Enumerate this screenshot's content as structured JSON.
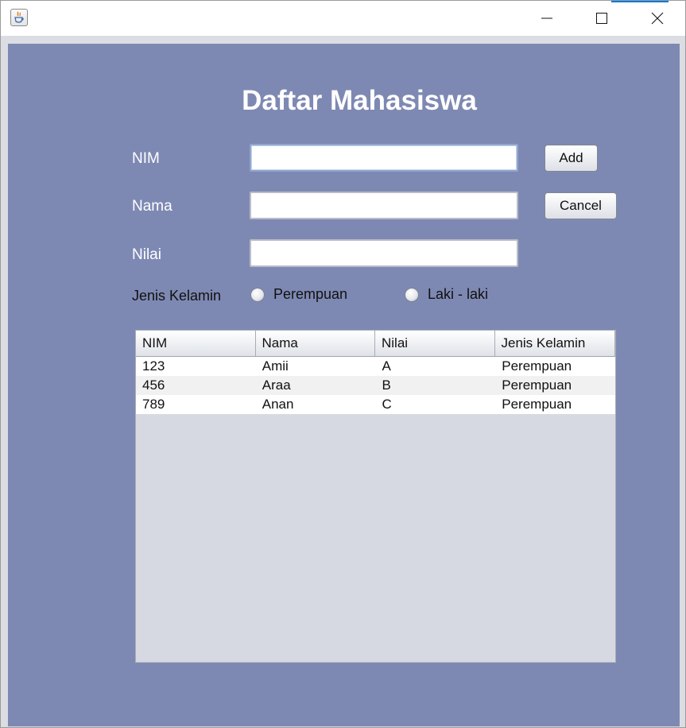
{
  "window": {
    "icon": "java-app-icon",
    "controls": [
      "minimize-icon",
      "maximize-icon",
      "close-icon"
    ]
  },
  "form": {
    "title": "Daftar Mahasiswa",
    "nim_label": "NIM",
    "nama_label": "Nama",
    "nilai_label": "Nilai",
    "nim_value": "",
    "nama_value": "",
    "nilai_value": "",
    "gender_label": "Jenis Kelamin",
    "gender_options": [
      "Perempuan",
      "Laki - laki"
    ],
    "add_label": "Add",
    "cancel_label": "Cancel"
  },
  "table": {
    "columns": [
      "NIM",
      "Nama",
      "Nilai",
      "Jenis Kelamin"
    ],
    "rows": [
      [
        "123",
        "Amii",
        "A",
        "Perempuan"
      ],
      [
        "456",
        "Araa",
        "B",
        "Perempuan"
      ],
      [
        "789",
        "Anan",
        "C",
        "Perempuan"
      ]
    ]
  },
  "colors": {
    "panel_bg": "#7e89b3",
    "table_empty_bg": "#d6d9e1",
    "title_text": "#ffffff"
  }
}
